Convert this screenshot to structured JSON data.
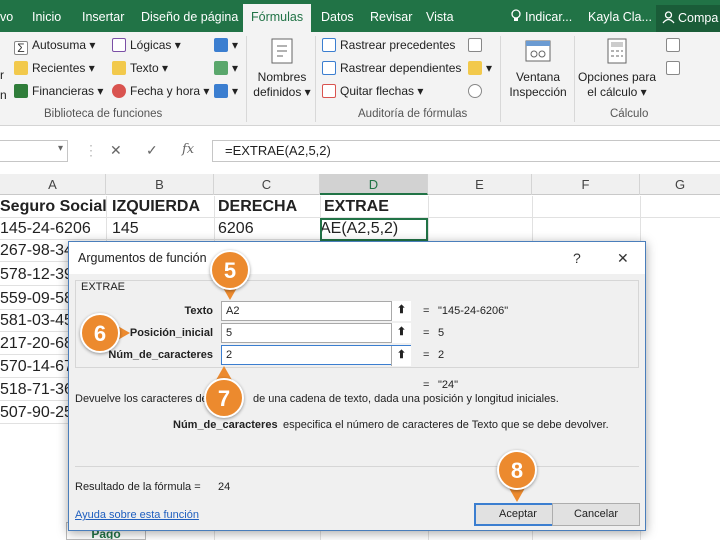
{
  "ribbon_tabs": {
    "file_partial": "vo",
    "home": "Inicio",
    "insert": "Insertar",
    "page_layout": "Diseño de página",
    "formulas": "Fórmulas",
    "data": "Datos",
    "review": "Revisar",
    "view": "Vista",
    "tell_me": "Indicar...",
    "user": "Kayla Cla...",
    "share": "Compa"
  },
  "ribbon": {
    "function_library": {
      "partial_insert_labels": [
        "r",
        "n"
      ],
      "autosum": "Autosuma",
      "recent": "Recientes",
      "financial": "Financieras",
      "logical": "Lógicas",
      "text": "Texto",
      "date_time": "Fecha y hora",
      "group_label": "Biblioteca de funciones"
    },
    "defined_names": {
      "label_line1": "Nombres",
      "label_line2": "definidos"
    },
    "formula_auditing": {
      "trace_precedents": "Rastrear precedentes",
      "trace_dependents": "Rastrear dependientes",
      "remove_arrows": "Quitar flechas",
      "group_label": "Auditoría de fórmulas"
    },
    "watch_window": {
      "label_line1": "Ventana",
      "label_line2": "Inspección"
    },
    "calculation": {
      "label_line1": "Opciones para",
      "label_line2": "el cálculo",
      "group_label": "Cálculo"
    }
  },
  "formula_bar": {
    "cancel_glyph": "✕",
    "enter_glyph": "✓",
    "fx_glyph": "fx",
    "formula": "=EXTRAE(A2,5,2)"
  },
  "grid": {
    "columns": [
      "A",
      "B",
      "C",
      "D",
      "E",
      "F",
      "G"
    ],
    "header_row": [
      "Seguro Social",
      "IZQUIERDA",
      "DERECHA",
      "EXTRAE"
    ],
    "row2": [
      "145-24-6206",
      "145",
      "6206",
      "AE(A2,5,2)"
    ],
    "col_a_partial": [
      "267-98-34",
      "578-12-39",
      "559-09-58",
      "581-03-45",
      "217-20-68",
      "570-14-67",
      "518-71-36",
      "507-90-25"
    ],
    "sheet_tab": "Pago"
  },
  "dialog": {
    "title": "Argumentos de función",
    "help_glyph": "?",
    "close_glyph": "✕",
    "function_name": "EXTRAE",
    "args": [
      {
        "label": "Texto",
        "value": "A2",
        "result": "\"145-24-6206\""
      },
      {
        "label": "Posición_inicial",
        "value": "5",
        "result": "5"
      },
      {
        "label": "Núm_de_caracteres",
        "value": "2",
        "result": "2"
      }
    ],
    "ref_button_glyph": "⬆",
    "equals": "=",
    "overall_result": "\"24\"",
    "description_left": "Devuelve los caracteres de",
    "description_right": "de una cadena de texto, dada una posición y longitud iniciales.",
    "arg_help_name": "Núm_de_caracteres",
    "arg_help_text": "especifica el número de caracteres de Texto que se debe devolver.",
    "formula_result_label": "Resultado de la fórmula =",
    "formula_result_value": "24",
    "help_link": "Ayuda sobre esta función",
    "ok": "Aceptar",
    "cancel": "Cancelar"
  },
  "callouts": [
    "5",
    "6",
    "7",
    "8"
  ],
  "colors": {
    "excel_green": "#217346",
    "callout_orange": "#ec8a2e",
    "link_blue": "#1f5fbf"
  }
}
